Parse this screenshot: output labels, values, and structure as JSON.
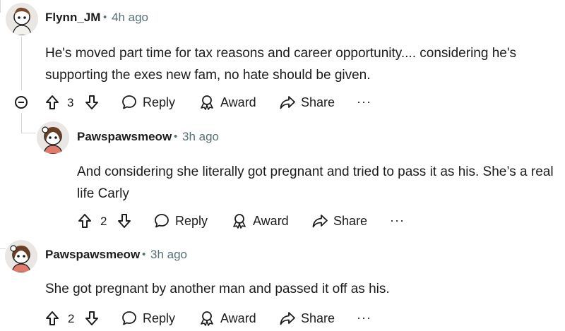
{
  "comments": [
    {
      "username": "Flynn_JM",
      "separator": "•",
      "time": "4h ago",
      "text": "He's moved part time for tax reasons and career opportunity.... considering he's supporting the exes new fam, no hate should be given.",
      "votes": "3",
      "actions": {
        "reply": "Reply",
        "award": "Award",
        "share": "Share",
        "more": "···"
      }
    },
    {
      "username": "Pawspawsmeow",
      "separator": "•",
      "time": "3h ago",
      "text": "And considering she literally got pregnant and tried to pass it as his. She’s a real life Carly",
      "votes": "2",
      "actions": {
        "reply": "Reply",
        "award": "Award",
        "share": "Share",
        "more": "···"
      }
    },
    {
      "username": "Pawspawsmeow",
      "separator": "•",
      "time": "3h ago",
      "text": "She got pregnant by another man and passed it off as his.",
      "votes": "2",
      "actions": {
        "reply": "Reply",
        "award": "Award",
        "share": "Share",
        "more": "···"
      }
    }
  ],
  "icons": {
    "upvote": "upvote-arrow-icon",
    "downvote": "downvote-arrow-icon",
    "reply": "speech-bubble-icon",
    "award": "award-ribbon-icon",
    "share": "share-arrow-icon",
    "collapse": "collapse-minus-icon"
  },
  "colors": {
    "text": "#1c1c1c",
    "meta": "#576f76",
    "thread": "#d3d6da"
  }
}
